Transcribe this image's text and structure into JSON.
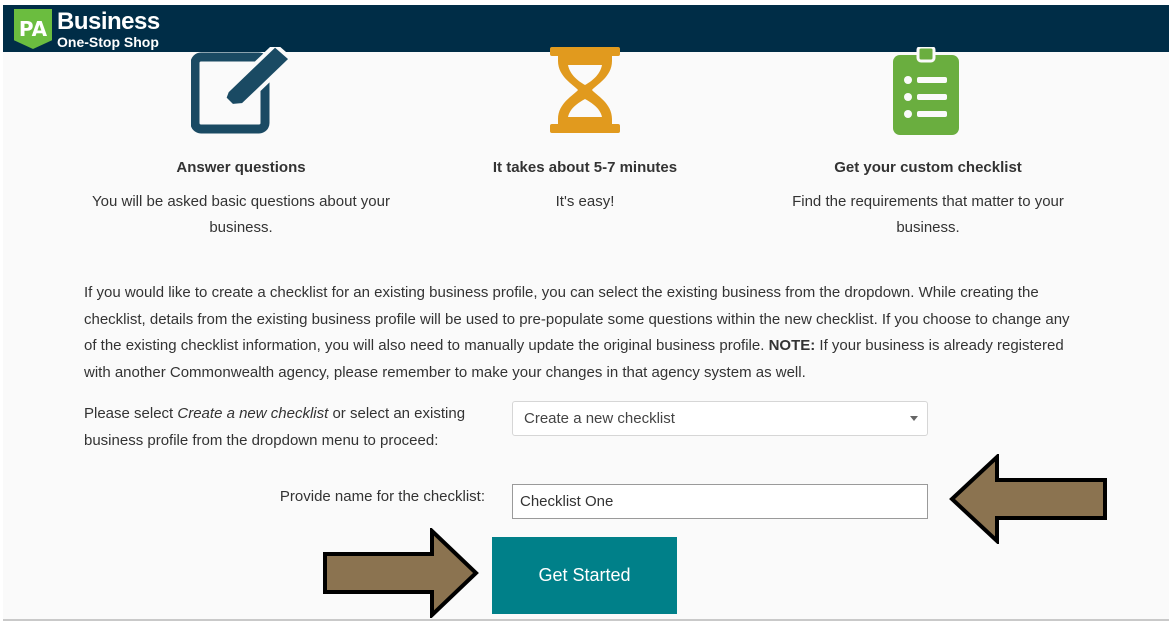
{
  "header": {
    "logo_badge": "PA",
    "logo_line1": "Business",
    "logo_line2": "One-Stop Shop",
    "background": "#002d47"
  },
  "steps": [
    {
      "title": "Answer questions",
      "description": "You will be asked basic questions about your business.",
      "icon": "edit-icon",
      "color": "#1a4a63"
    },
    {
      "title": "It takes about 5-7 minutes",
      "description": "It's easy!",
      "icon": "hourglass-icon",
      "color": "#e19a1e"
    },
    {
      "title": "Get your custom checklist",
      "description": "Find the requirements that matter to your business.",
      "icon": "clipboard-checklist-icon",
      "color": "#6aae3f"
    }
  ],
  "intro": {
    "text_before_note": "If you would like to create a checklist for an existing business profile, you can select the existing business from the dropdown. While creating the checklist, details from the existing business profile will be used to pre-populate some questions within the new checklist. If you choose to change any of the existing checklist information, you will also need to manually update the original business profile.",
    "note_label": "NOTE:",
    "text_after_note": "If your business is already registered with another Commonwealth agency, please remember to make your changes in that agency system as well."
  },
  "profile_select": {
    "label_prefix": "Please select",
    "label_emphasis": "Create a new checklist",
    "label_suffix": "or select an existing business profile from the dropdown menu to proceed:",
    "selected_value": "Create a new checklist"
  },
  "checklist_name": {
    "label": "Provide name for the checklist:",
    "value": "Checklist One"
  },
  "get_started": {
    "label": "Get Started",
    "color": "#008089"
  },
  "annotation_arrows": {
    "color": "#8b7350"
  }
}
